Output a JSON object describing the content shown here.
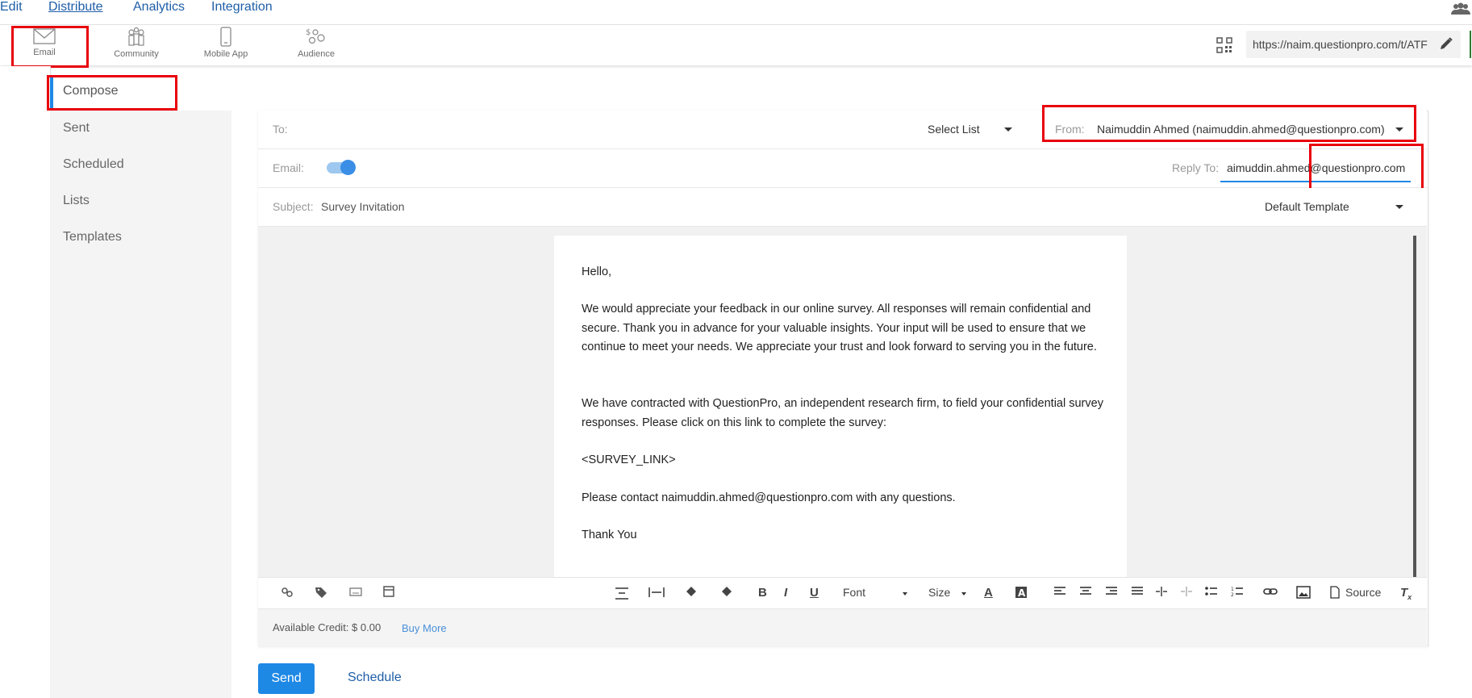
{
  "topnav": {
    "items": [
      {
        "label": "Edit"
      },
      {
        "label": "Distribute"
      },
      {
        "label": "Analytics"
      },
      {
        "label": "Integration"
      }
    ]
  },
  "channels": [
    {
      "label": "Email",
      "icon": "envelope-icon"
    },
    {
      "label": "Community",
      "icon": "community-icon"
    },
    {
      "label": "Mobile App",
      "icon": "mobile-icon"
    },
    {
      "label": "Audience",
      "icon": "audience-icon"
    }
  ],
  "survey_url": "https://naim.questionpro.com/t/ATF",
  "sidebar": {
    "items": [
      {
        "label": "Compose"
      },
      {
        "label": "Sent"
      },
      {
        "label": "Scheduled"
      },
      {
        "label": "Lists"
      },
      {
        "label": "Templates"
      }
    ]
  },
  "compose": {
    "to_label": "To:",
    "select_list": "Select List",
    "from_label": "From:",
    "from_value": "Naimuddin Ahmed (naimuddin.ahmed@questionpro.com)",
    "email_label": "Email:",
    "reply_to_label": "Reply To:",
    "reply_to_value": "aimuddin.ahmed@questionpro.com",
    "subject_label": "Subject:",
    "subject_value": "Survey Invitation",
    "template": "Default Template"
  },
  "body": {
    "p1": "Hello,",
    "p2": "We would appreciate your feedback in our online survey. All responses will remain confidential and secure. Thank you in advance for your valuable insights. Your input will be used to ensure that we continue to meet your needs. We appreciate your trust and look forward to serving you in the future.",
    "p3": "We have contracted with QuestionPro, an independent research firm, to field your confidential survey responses. Please click on this link to complete the survey:",
    "p4": "<SURVEY_LINK>",
    "p5": "Please contact naimuddin.ahmed@questionpro.com with any questions.",
    "p6": "Thank You"
  },
  "toolbar": {
    "font": "Font",
    "size": "Size",
    "source": "Source"
  },
  "credit": {
    "label": "Available Credit: $ 0.00",
    "buy_more": "Buy More"
  },
  "actions": {
    "send": "Send",
    "schedule": "Schedule"
  },
  "colors": {
    "accent": "#1e88e5",
    "highlight_box": "#e8000b"
  }
}
